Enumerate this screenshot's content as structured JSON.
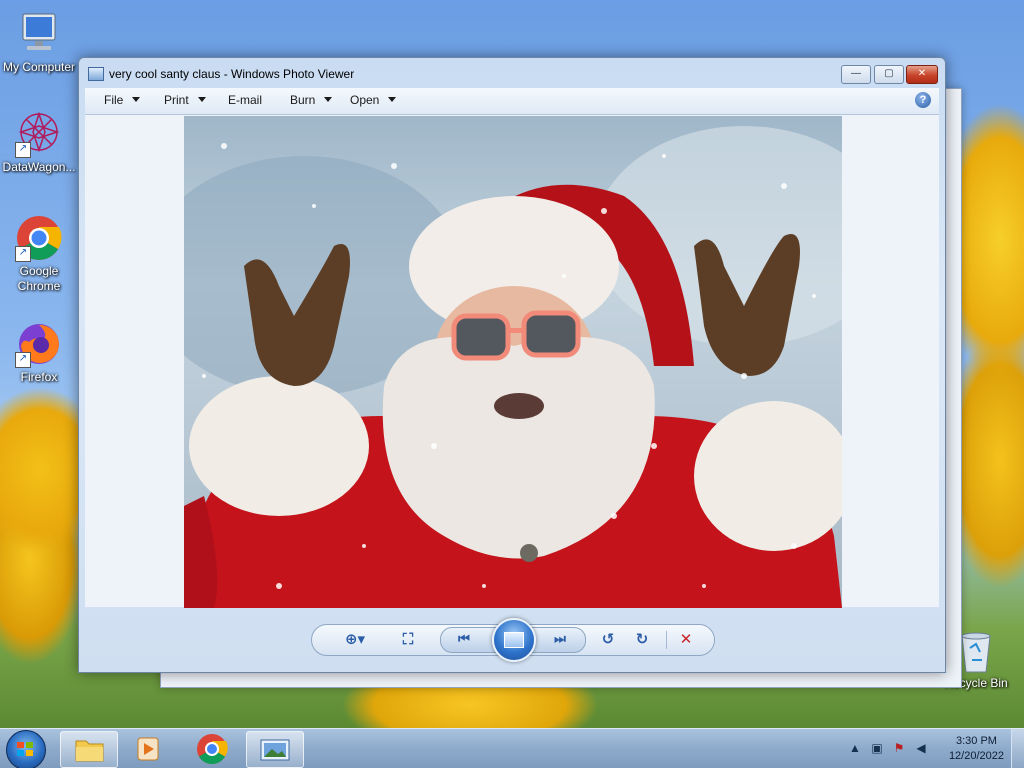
{
  "desktop": {
    "icons": [
      {
        "label": "My Computer"
      },
      {
        "label": "DataWagon..."
      },
      {
        "label": "Google Chrome"
      },
      {
        "label": "Firefox"
      },
      {
        "label": "Recycle Bin"
      }
    ]
  },
  "window": {
    "title": "very cool santy claus - Windows Photo Viewer",
    "buttons": {
      "minimize": "—",
      "maximize": "▢",
      "close": "✕"
    }
  },
  "menu": {
    "file": "File",
    "print": "Print",
    "email": "E-mail",
    "burn": "Burn",
    "open": "Open",
    "help": "?"
  },
  "controls": {
    "zoom": "⊕▾",
    "actual_size": "⛶",
    "previous": "⏮",
    "next": "⏭",
    "rotate_ccw": "↺",
    "rotate_cw": "↻",
    "delete": "✕"
  },
  "taskbar": {
    "time": "3:30 PM",
    "date": "12/20/2022"
  },
  "colors": {
    "accent": "#2c5da7",
    "delete": "#c8262a",
    "santa_red": "#c4131a"
  }
}
